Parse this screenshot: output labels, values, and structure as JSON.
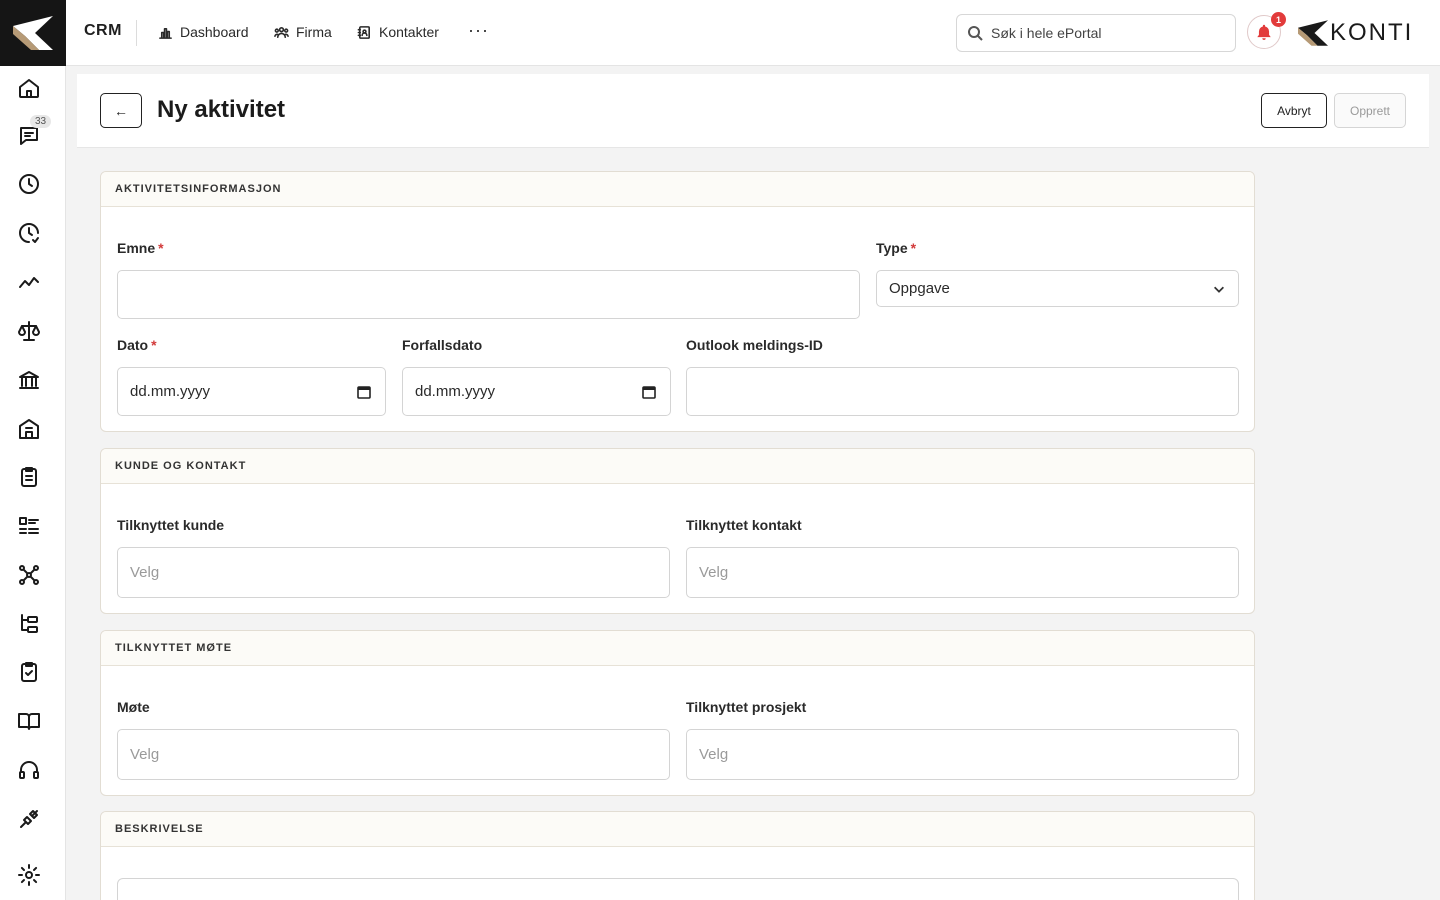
{
  "app": {
    "brand": "CRM",
    "logo_text": "KONTI"
  },
  "sidebar": {
    "badge": "33",
    "items": [
      {
        "name": "home-icon"
      },
      {
        "name": "chat-icon"
      },
      {
        "name": "clock-icon"
      },
      {
        "name": "clock-check-icon"
      },
      {
        "name": "trend-icon"
      },
      {
        "name": "scale-icon"
      },
      {
        "name": "bank-icon"
      },
      {
        "name": "building-icon"
      },
      {
        "name": "clipboard-icon"
      },
      {
        "name": "list-icon"
      },
      {
        "name": "network-icon"
      },
      {
        "name": "tree-icon"
      },
      {
        "name": "clipboard-check-icon"
      },
      {
        "name": "book-icon"
      },
      {
        "name": "headset-icon"
      },
      {
        "name": "plug-icon"
      },
      {
        "name": "gear-icon"
      }
    ]
  },
  "topnav": {
    "items": [
      "Dashboard",
      "Firma",
      "Kontakter"
    ],
    "more": "···",
    "search_placeholder": "Søk i hele ePortal",
    "notification_count": "1"
  },
  "header": {
    "back": "←",
    "title": "Ny aktivitet",
    "cancel": "Avbryt",
    "create": "Opprett"
  },
  "sections": {
    "activity": {
      "title": "AKTIVITETSINFORMASJON",
      "subject_label": "Emne",
      "subject_value": "",
      "type_label": "Type",
      "type_value": "Oppgave",
      "date_label": "Dato",
      "date_placeholder": "dd.mm.yyyy",
      "due_label": "Forfallsdato",
      "due_placeholder": "dd.mm.yyyy",
      "outlook_label": "Outlook meldings-ID",
      "outlook_value": "",
      "required_mark": "*"
    },
    "customer": {
      "title": "KUNDE OG KONTAKT",
      "customer_label": "Tilknyttet kunde",
      "customer_placeholder": "Velg",
      "contact_label": "Tilknyttet kontakt",
      "contact_placeholder": "Velg"
    },
    "meeting": {
      "title": "TILKNYTTET MØTE",
      "meeting_label": "Møte",
      "meeting_placeholder": "Velg",
      "project_label": "Tilknyttet prosjekt",
      "project_placeholder": "Velg"
    },
    "description": {
      "title": "BESKRIVELSE"
    }
  }
}
